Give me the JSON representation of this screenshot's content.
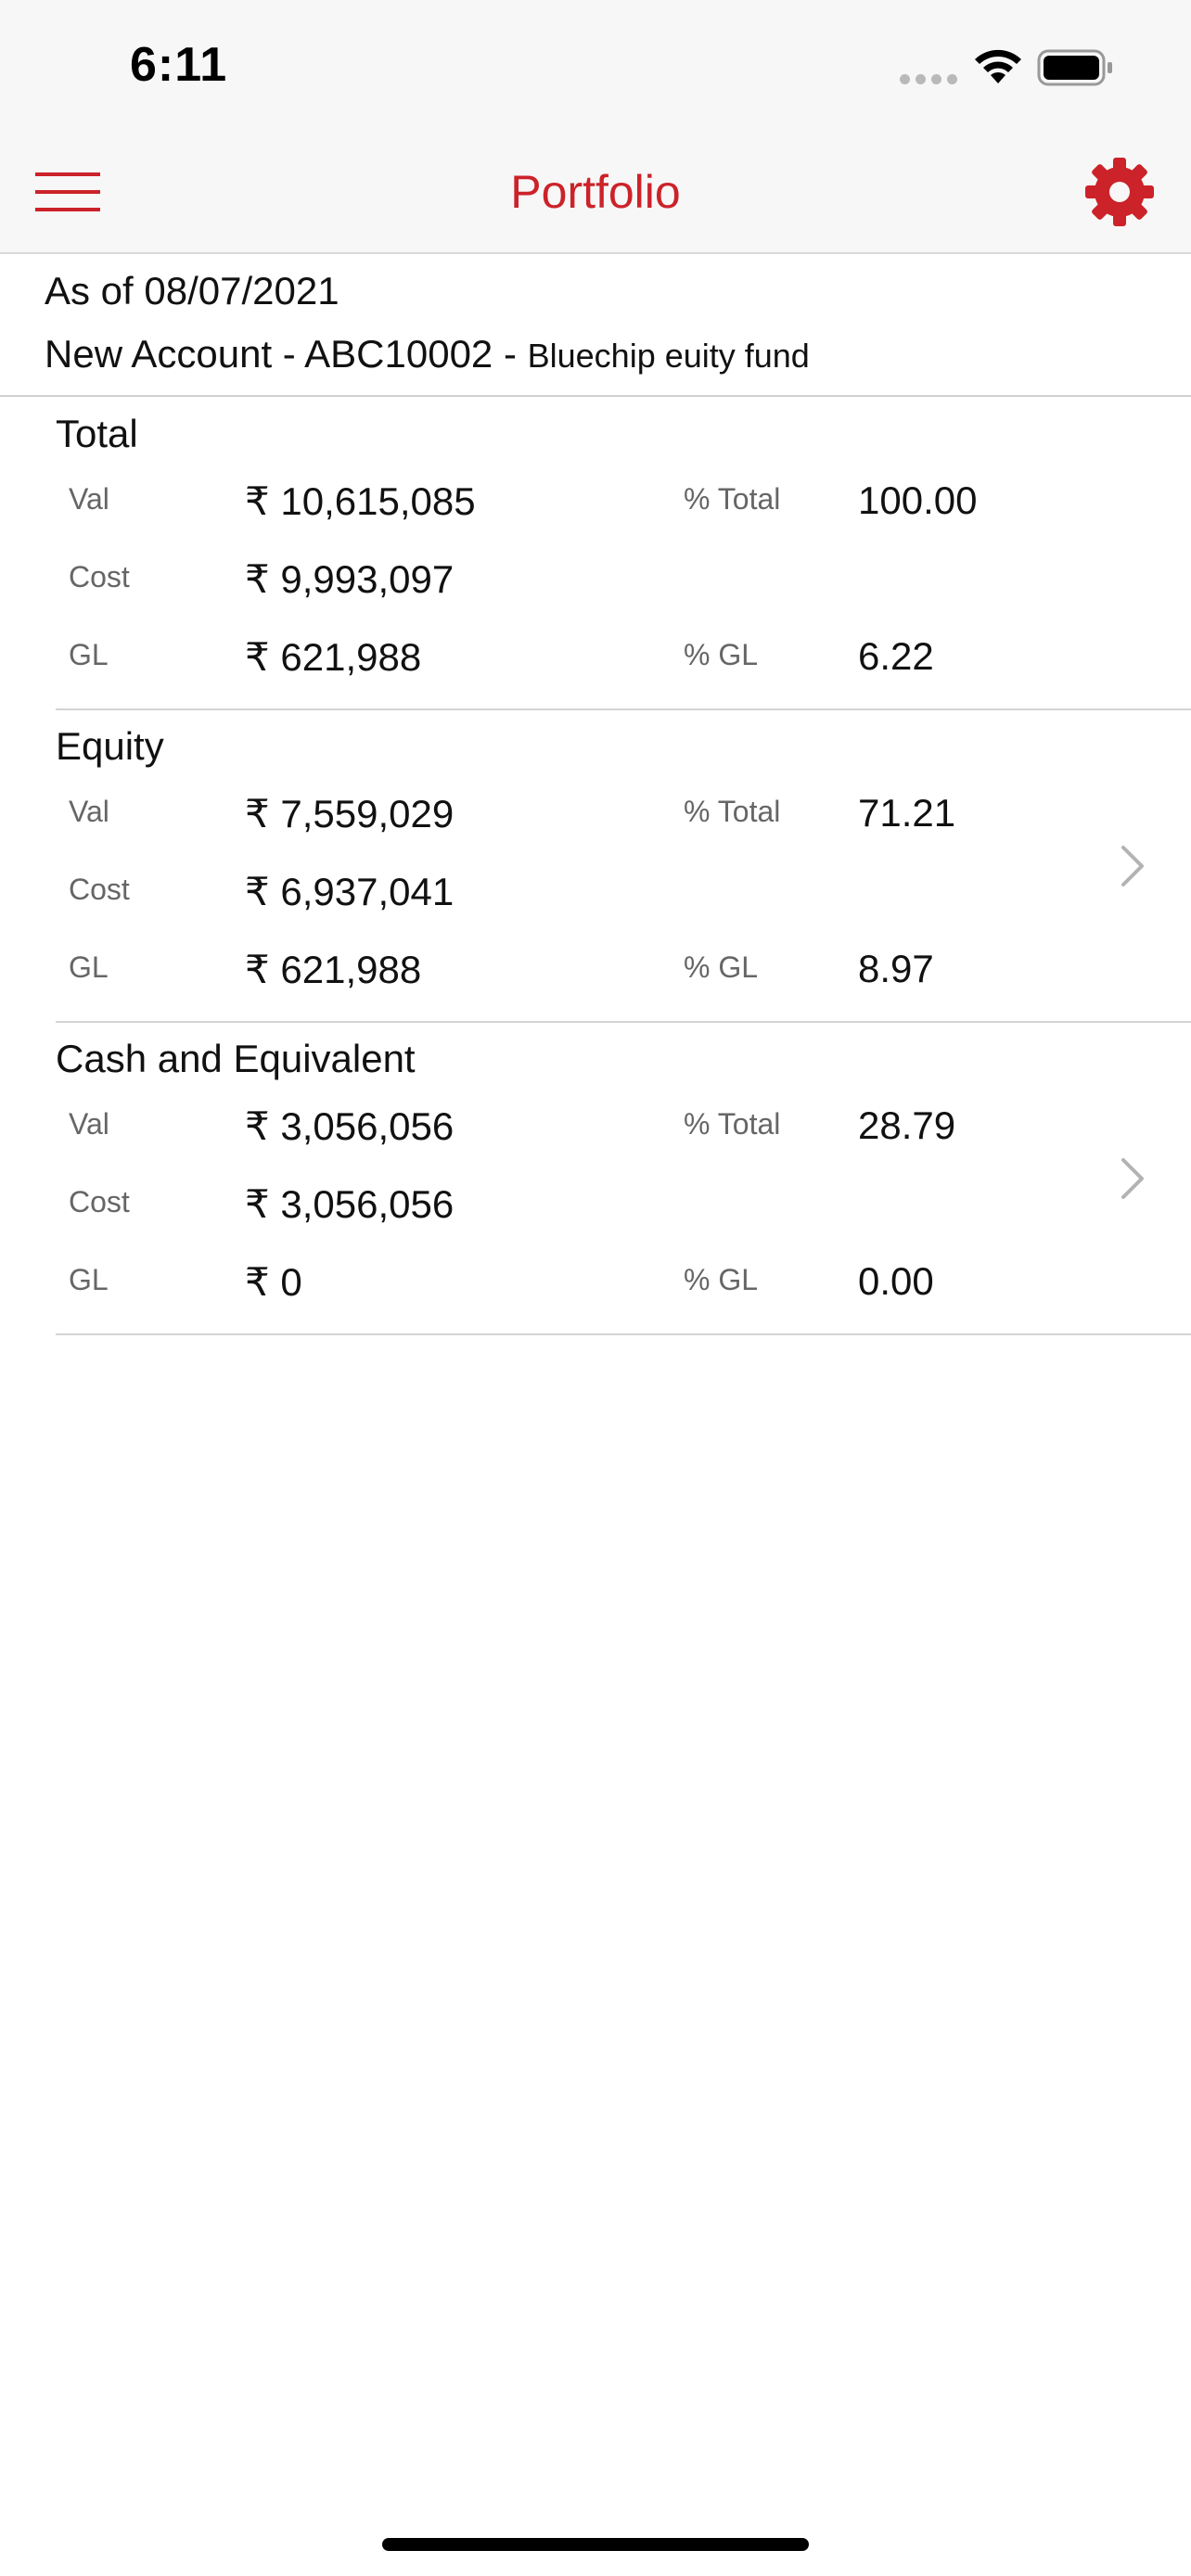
{
  "status_bar": {
    "time": "6:11"
  },
  "nav": {
    "title": "Portfolio",
    "menu_icon": "hamburger-menu-icon",
    "settings_icon": "gear-icon",
    "accent_color": "#cc2229"
  },
  "header": {
    "as_of": "As of 08/07/2021",
    "account_name": "New Account - ABC10002",
    "separator": " - ",
    "fund_name": "Bluechip euity fund"
  },
  "sections": [
    {
      "title": "Total",
      "labels": {
        "val": "Val",
        "cost": "Cost",
        "gl": "GL",
        "pct_total": "% Total",
        "pct_gl": "% GL"
      },
      "val": "₹ 10,615,085",
      "cost": "₹ 9,993,097",
      "gl": "₹ 621,988",
      "pct_total": "100.00",
      "pct_gl": "6.22",
      "has_chevron": false
    },
    {
      "title": "Equity",
      "labels": {
        "val": "Val",
        "cost": "Cost",
        "gl": "GL",
        "pct_total": "% Total",
        "pct_gl": "% GL"
      },
      "val": "₹ 7,559,029",
      "cost": "₹ 6,937,041",
      "gl": "₹ 621,988",
      "pct_total": "71.21",
      "pct_gl": "8.97",
      "has_chevron": true
    },
    {
      "title": "Cash and Equivalent",
      "labels": {
        "val": "Val",
        "cost": "Cost",
        "gl": "GL",
        "pct_total": "% Total",
        "pct_gl": "% GL"
      },
      "val": "₹ 3,056,056",
      "cost": "₹ 3,056,056",
      "gl": "₹ 0",
      "pct_total": "28.79",
      "pct_gl": "0.00",
      "has_chevron": true
    }
  ]
}
